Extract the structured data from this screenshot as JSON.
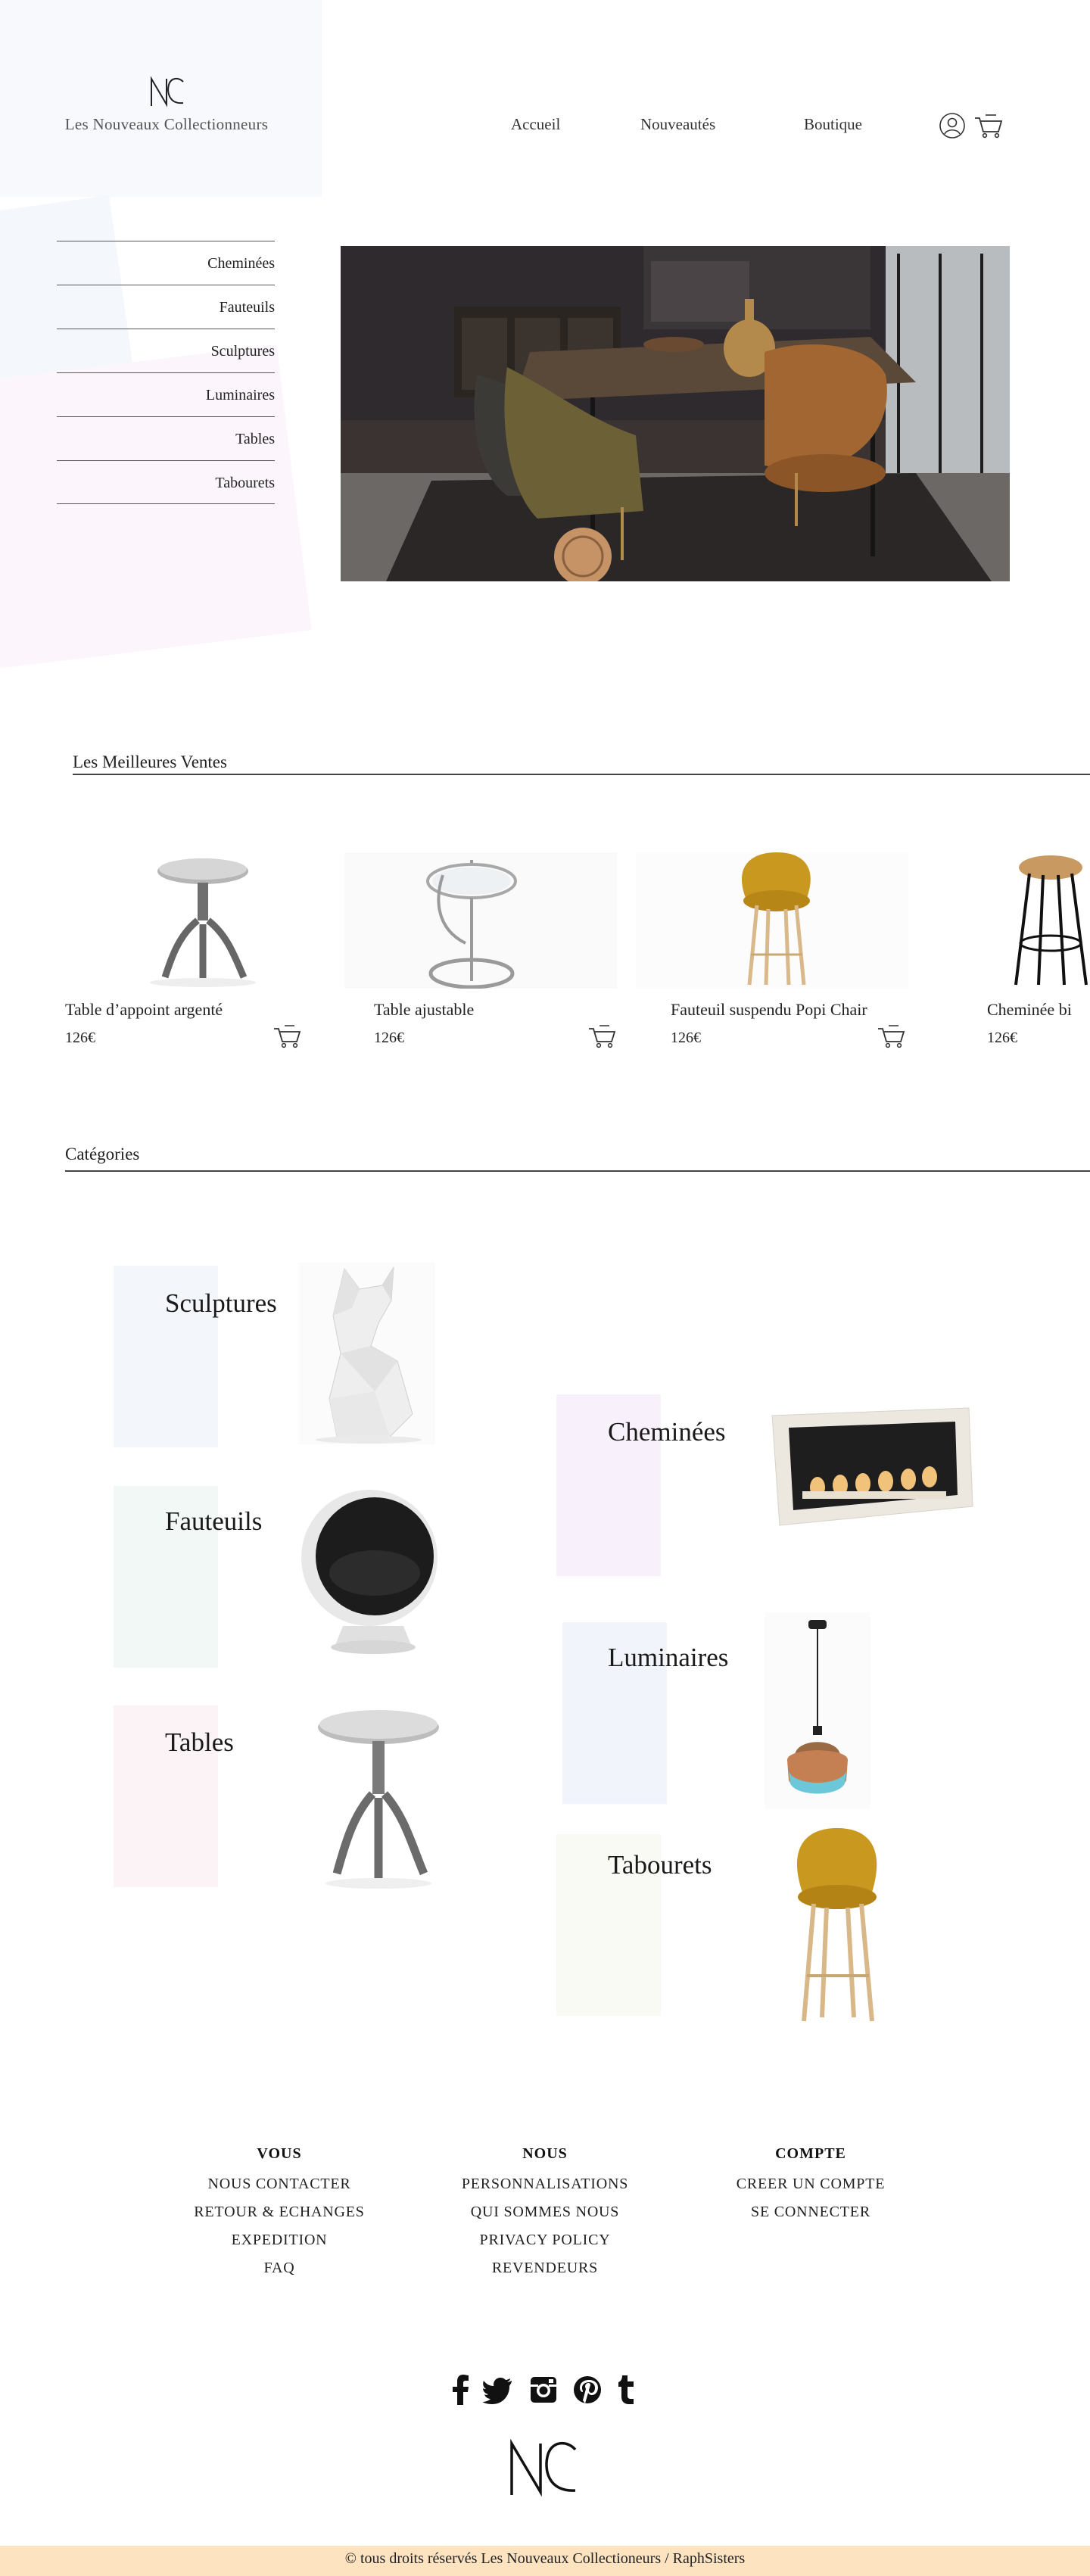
{
  "brand": {
    "name": "Les Nouveaux Collectionneurs"
  },
  "nav": {
    "items": [
      {
        "label": "Accueil"
      },
      {
        "label": "Nouveautés"
      },
      {
        "label": "Boutique"
      }
    ],
    "icons": [
      "user-icon",
      "cart-icon"
    ]
  },
  "sidebar": {
    "items": [
      {
        "label": "Cheminées"
      },
      {
        "label": "Fauteuils"
      },
      {
        "label": "Sculptures"
      },
      {
        "label": "Luminaires"
      },
      {
        "label": "Tables"
      },
      {
        "label": "Tabourets"
      }
    ]
  },
  "best_sellers": {
    "title": "Les Meilleures Ventes",
    "products": [
      {
        "name": "Table d’appoint argenté",
        "price": "126€"
      },
      {
        "name": "Table ajustable",
        "price": "126€"
      },
      {
        "name": "Fauteuil suspendu Popi Chair",
        "price": "126€"
      },
      {
        "name": "Cheminée bi",
        "price": "126€"
      }
    ]
  },
  "categories": {
    "title": "Catégories",
    "items": [
      {
        "label": "Sculptures",
        "color": "#f3f6fb"
      },
      {
        "label": "Fauteuils",
        "color": "#f2f8f5"
      },
      {
        "label": "Tables",
        "color": "#fbf3f5"
      },
      {
        "label": "Cheminées",
        "color": "#f8f1fb"
      },
      {
        "label": "Luminaires",
        "color": "#f1f5fb"
      },
      {
        "label": "Tabourets",
        "color": "#f8faf3"
      }
    ]
  },
  "footer": {
    "columns": [
      {
        "heading": "VOUS",
        "links": [
          "NOUS CONTACTER",
          "RETOUR & ECHANGES",
          "EXPEDITION",
          "FAQ"
        ]
      },
      {
        "heading": "NOUS",
        "links": [
          "PERSONNALISATIONS",
          "QUI SOMMES NOUS",
          "PRIVACY POLICY",
          "REVENDEURS"
        ]
      },
      {
        "heading": "COMPTE",
        "links": [
          "CREER UN COMPTE",
          "SE CONNECTER"
        ]
      }
    ],
    "social": [
      "facebook-icon",
      "twitter-icon",
      "instagram-icon",
      "pinterest-icon",
      "tumblr-icon"
    ],
    "copyright": "© tous droits réservés Les Nouveaux Collectioneurs / RaphSisters",
    "copyright_bg": "#fde3c0"
  }
}
